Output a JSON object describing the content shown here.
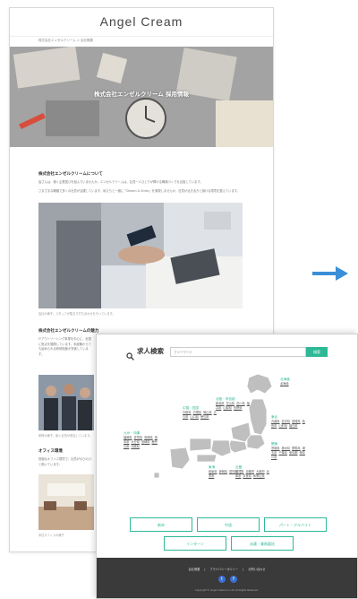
{
  "site": {
    "title": "Angel Cream",
    "breadcrumb": "株式会社エンゼルクリーム > 会社概要",
    "hero_title": "株式会社エンゼルクリーム 採用情報"
  },
  "article": {
    "section1_title": "株式会社エンゼルクリームについて",
    "section1_body1": "皆さんは、働く企業選びを悩んでいませんか。エンゼルクリームは、社員一人ひとりが輝ける職場づくりを目指しています。",
    "section1_body2": "さまざまな職種で多くの社員が活躍しています。私たちと一緒に「Dream & Smile」を実現しませんか。社員が活き活きと働ける環境を整えています。",
    "photo1_caption": "会社の様子。スタッフが集まり打ち合わせを行っています。",
    "section2_title": "株式会社エンゼルクリームの魅力",
    "section2_body": "ITアウトソーシング事業を中心に、全国に拠点を展開しています。未経験からでも始められる研修制度が充実しています。",
    "photo2_caption": "研修の様子。新入社員が参加しています。",
    "section3_title": "オフィス環境",
    "section3_body": "快適なオフィス環境で、社員がのびのびと働いています。",
    "photo3_caption": "本社オフィスの様子"
  },
  "search": {
    "label": "求人検索",
    "placeholder": "フリーワード",
    "button": "検索"
  },
  "regions": [
    {
      "name": "北海道",
      "prefs": [
        "北海道"
      ]
    },
    {
      "name": "東北",
      "prefs": [
        "青森県",
        "岩手県",
        "宮城県",
        "秋田県",
        "山形県",
        "福島県"
      ]
    },
    {
      "name": "関東",
      "prefs": [
        "茨城県",
        "栃木県",
        "群馬県",
        "埼玉県",
        "千葉県",
        "東京都",
        "神奈川県"
      ]
    },
    {
      "name": "北陸・甲信越",
      "prefs": [
        "新潟県",
        "富山県",
        "石川県",
        "福井県",
        "山梨県",
        "長野県"
      ]
    },
    {
      "name": "東海",
      "prefs": [
        "岐阜県",
        "静岡県",
        "愛知県",
        "三重県"
      ]
    },
    {
      "name": "近畿",
      "prefs": [
        "滋賀県",
        "京都府",
        "大阪府",
        "兵庫県",
        "奈良県",
        "和歌山県"
      ]
    },
    {
      "name": "中国・四国",
      "prefs": [
        "鳥取県",
        "島根県",
        "岡山県",
        "広島県",
        "山口県",
        "徳島県"
      ]
    },
    {
      "name": "九州・沖縄",
      "prefs": [
        "福岡県",
        "佐賀県",
        "長崎県",
        "熊本県",
        "大分県",
        "宮崎県",
        "鹿児島県",
        "沖縄県"
      ]
    }
  ],
  "categories": [
    {
      "label": "新卒"
    },
    {
      "label": "中途"
    },
    {
      "label": "パート・アルバイト"
    },
    {
      "label": "インターン"
    },
    {
      "label": "派遣・業務委託"
    }
  ],
  "footer": {
    "links": [
      "会社概要",
      "プライバシーポリシー",
      "お問い合わせ"
    ],
    "copyright": "Copyright © Angel Cream Co.,Ltd. All Rights Reserved."
  },
  "colors": {
    "accent": "#2eb897",
    "footer_bg": "#3a3a3a",
    "arrow": "#3b8fd8",
    "social": "#3b6fd1"
  },
  "icons": {
    "search": "search-icon",
    "arrow": "right-arrow-icon",
    "twitter": "twitter-icon",
    "facebook": "facebook-icon"
  }
}
